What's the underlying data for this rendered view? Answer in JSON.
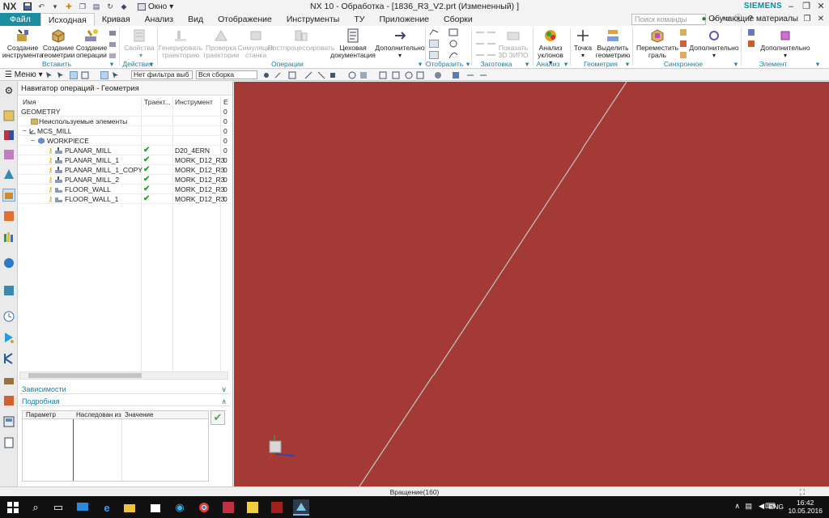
{
  "titlebar": {
    "logo": "NX",
    "window_menu": "Окно",
    "title": "NX 10 - Обработка - [1836_R3_V2.prt (Измененный) ]",
    "brand": "SIEMENS"
  },
  "ribbon_tabs": [
    "Файл",
    "Исходная",
    "Кривая",
    "Анализ",
    "Вид",
    "Отображение",
    "Инструменты",
    "ТУ",
    "Приложение",
    "Сборки"
  ],
  "search": {
    "placeholder": "Поиск команды"
  },
  "learning_label": "Обучающие материалы",
  "ribbon": {
    "buttons": [
      {
        "label": "Создание\nинструмента",
        "enabled": true
      },
      {
        "label": "Создание\nгеометрии",
        "enabled": true
      },
      {
        "label": "Создание\nоперации",
        "enabled": true
      },
      {
        "label": "Свойства",
        "enabled": false
      },
      {
        "label": "Генерировать\nтраекторию",
        "enabled": false
      },
      {
        "label": "Проверка\nтраектории",
        "enabled": false
      },
      {
        "label": "Симуляция\nстанка",
        "enabled": false
      },
      {
        "label": "Постпроцессировать",
        "enabled": false
      },
      {
        "label": "Цеховая\nдокументация",
        "enabled": true
      },
      {
        "label": "Дополнительно",
        "enabled": true
      },
      {
        "label": "Показать\n3D ЗИПО",
        "enabled": false
      },
      {
        "label": "Анализ\nуклонов",
        "enabled": true
      },
      {
        "label": "Точка",
        "enabled": true
      },
      {
        "label": "Выделить\nгеометрию",
        "enabled": true
      },
      {
        "label": "Переместить\nграль",
        "enabled": true
      },
      {
        "label": "Дополнительно",
        "enabled": true
      },
      {
        "label": "Дополнительно",
        "enabled": true
      }
    ],
    "groups": [
      "Вставить",
      "Действия",
      "Операции",
      "Отобразить",
      "Заготовка",
      "Анализ",
      "Геометрия",
      "Синхронное моделирование",
      "Элемент"
    ]
  },
  "topbar": {
    "menu_label": "Меню",
    "filter_value": "Нет фильтра выб",
    "assembly_value": "Вся сборка"
  },
  "navigator": {
    "title": "Навигатор операций - Геометрия",
    "columns": [
      "Имя",
      "Траект...",
      "Инструмент",
      "Е"
    ],
    "rows": [
      {
        "name": "GEOMETRY",
        "indent": 0,
        "icon": "none",
        "check": false,
        "tool": "",
        "last": "0"
      },
      {
        "name": "Неиспользуемые элементы",
        "indent": 1,
        "icon": "folder",
        "check": false,
        "tool": "",
        "last": "0"
      },
      {
        "name": "MCS_MILL",
        "indent": 1,
        "icon": "mcs",
        "check": false,
        "tool": "",
        "last": "0"
      },
      {
        "name": "WORKPIECE",
        "indent": 2,
        "icon": "workpiece",
        "check": false,
        "tool": "",
        "last": "0"
      },
      {
        "name": "PLANAR_MILL",
        "indent": 3,
        "icon": "operation",
        "check": true,
        "tool": "D20_4ERN",
        "last": "0"
      },
      {
        "name": "PLANAR_MILL_1",
        "indent": 3,
        "icon": "operation",
        "check": true,
        "tool": "MORK_D12_R3",
        "last": "0"
      },
      {
        "name": "PLANAR_MILL_1_COPY",
        "indent": 3,
        "icon": "operation",
        "check": true,
        "tool": "MORK_D12_R3",
        "last": "0"
      },
      {
        "name": "PLANAR_MILL_2",
        "indent": 3,
        "icon": "operation",
        "check": true,
        "tool": "MORK_D12_R3",
        "last": "0"
      },
      {
        "name": "FLOOR_WALL",
        "indent": 3,
        "icon": "operation",
        "check": true,
        "tool": "MORK_D12_R3",
        "last": "0"
      },
      {
        "name": "FLOOR_WALL_1",
        "indent": 3,
        "icon": "operation",
        "check": true,
        "tool": "MORK_D12_R3",
        "last": "0"
      }
    ],
    "dependencies_label": "Зависимости",
    "details_label": "Подробная",
    "details_columns": [
      "Параметр",
      "Наследован из",
      "Значение"
    ]
  },
  "graphics": {
    "background_color": "#a33a35",
    "wcs_label": "—"
  },
  "status_text": "Вращение(160)",
  "taskbar": {
    "lang": "ENG",
    "time": "16:42",
    "date": "10.05.2016"
  }
}
